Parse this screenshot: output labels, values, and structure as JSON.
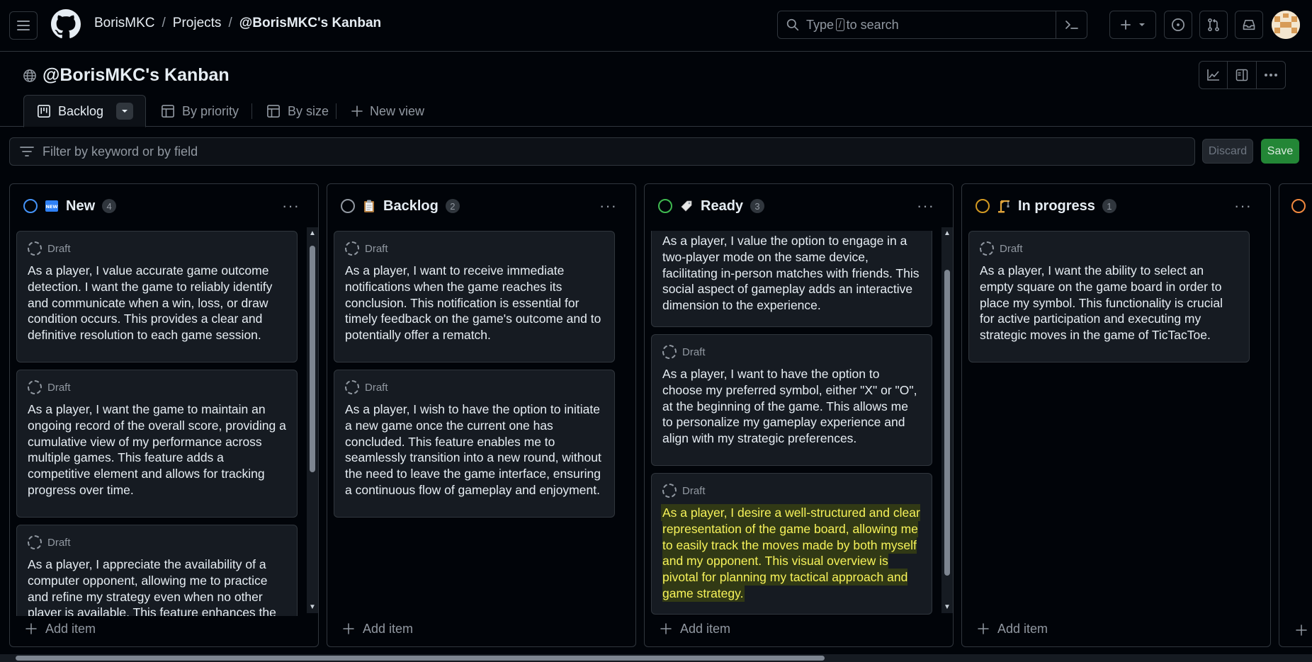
{
  "breadcrumb": {
    "owner": "BorisMKC",
    "projects": "Projects",
    "sep": "/",
    "current": "@BorisMKC's Kanban"
  },
  "search": {
    "prefix": "Type",
    "kbd": "/",
    "suffix": "to search"
  },
  "project": {
    "title": "@BorisMKC's Kanban"
  },
  "tabs": [
    {
      "label": "Backlog"
    },
    {
      "label": "By priority"
    },
    {
      "label": "By size"
    },
    {
      "label": "New view"
    }
  ],
  "filter": {
    "placeholder": "Filter by keyword or by field"
  },
  "buttons": {
    "discard": "Discard",
    "save": "Save"
  },
  "colors": {
    "new": "#4493f8",
    "backlog": "#9198a1",
    "ready": "#3fb950",
    "in_progress": "#d29922",
    "done": "#f0883e",
    "save": "#238636"
  },
  "columns": [
    {
      "name": "New",
      "emoji": "🆕",
      "count": "4",
      "add": "Add item",
      "cards": [
        {
          "status": "Draft",
          "text": "As a player, I value accurate game outcome detection. I want the game to reliably identify and communicate when a win, loss, or draw condition occurs. This provides a clear and definitive resolution to each game session."
        },
        {
          "status": "Draft",
          "text": "As a player, I want the game to maintain an ongoing record of the overall score, providing a cumulative view of my performance across multiple games. This feature adds a competitive element and allows for tracking progress over time."
        },
        {
          "status": "Draft",
          "text": "As a player, I appreciate the availability of a computer opponent, allowing me to practice and refine my strategy even when no other player is available. This feature enhances the"
        }
      ]
    },
    {
      "name": "Backlog",
      "emoji": "📋",
      "count": "2",
      "add": "Add item",
      "cards": [
        {
          "status": "Draft",
          "text": "As a player, I want to receive immediate notifications when the game reaches its conclusion. This notification is essential for timely feedback on the game's outcome and to potentially offer a rematch."
        },
        {
          "status": "Draft",
          "text": "As a player, I wish to have the option to initiate a new game once the current one has concluded. This feature enables me to seamlessly transition into a new round, without the need to leave the game interface, ensuring a continuous flow of gameplay and enjoyment."
        }
      ]
    },
    {
      "name": "Ready",
      "emoji": "🏷️",
      "count": "3",
      "add": "Add item",
      "cards": [
        {
          "status": "",
          "text": "As a player, I value the option to engage in a two-player mode on the same device, facilitating in-person matches with friends. This social aspect of gameplay adds an interactive dimension to the experience."
        },
        {
          "status": "Draft",
          "text": "As a player, I want to have the option to choose my preferred symbol, either \"X\" or \"O\", at the beginning of the game. This allows me to personalize my gameplay experience and align with my strategic preferences."
        },
        {
          "status": "Draft",
          "text": "As a player, I desire a well-structured and clear representation of the game board, allowing me to easily track the moves made by both myself and my opponent. This visual overview is pivotal for planning my tactical approach and game strategy."
        }
      ]
    },
    {
      "name": "In progress",
      "emoji": "🏗️",
      "count": "1",
      "add": "Add item",
      "cards": [
        {
          "status": "Draft",
          "text": "As a player, I want the ability to select an empty square on the game board in order to place my symbol. This functionality is crucial for active participation and executing my strategic moves in the game of TicTacToe."
        }
      ]
    }
  ]
}
